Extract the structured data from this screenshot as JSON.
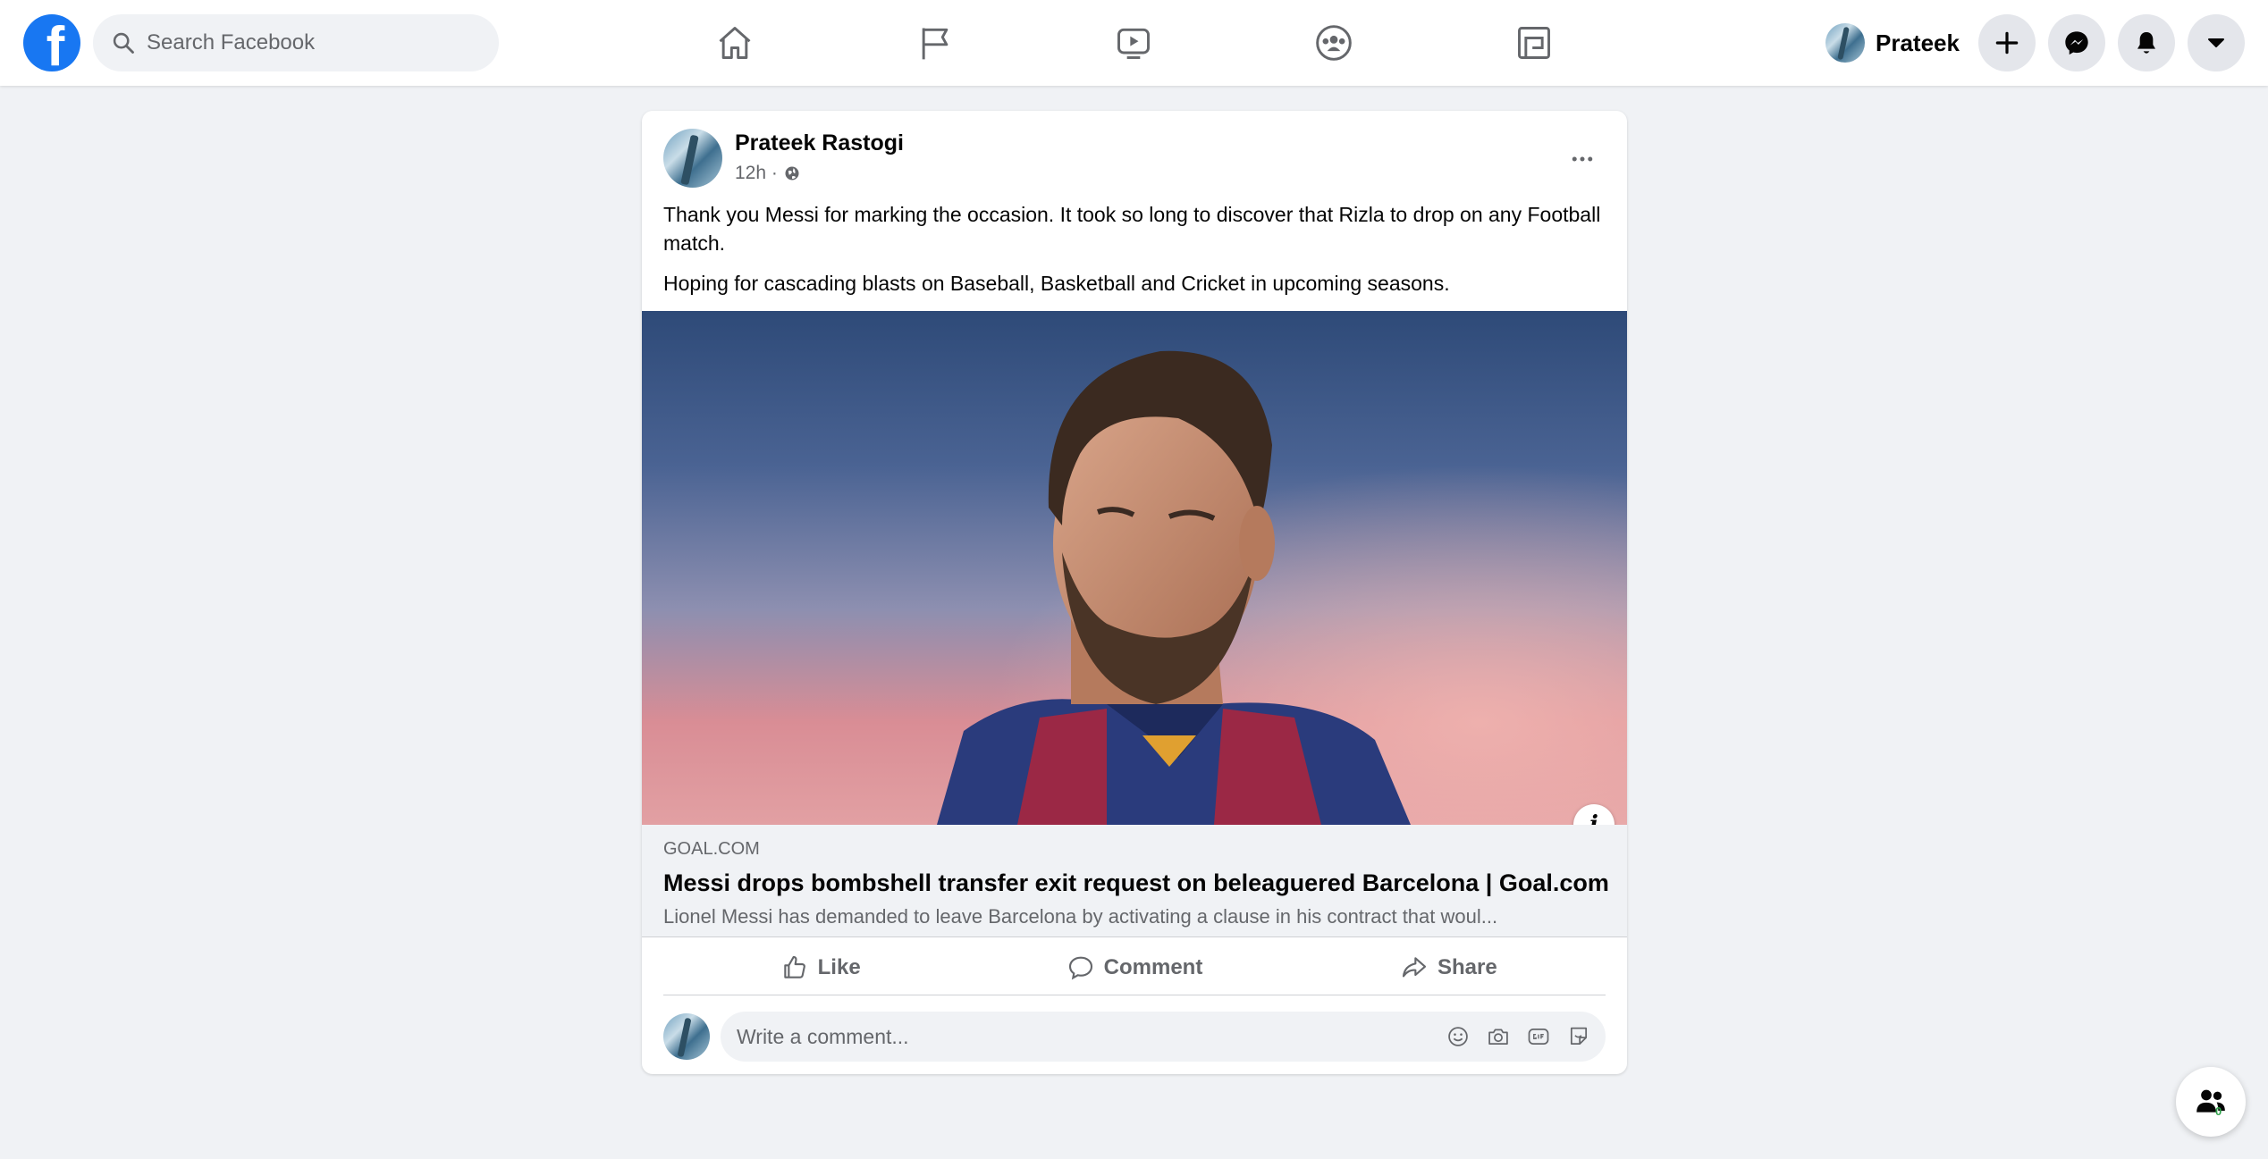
{
  "topbar": {
    "logo": "facebook-logo",
    "search_placeholder": "Search Facebook",
    "nav_icons": [
      "home-icon",
      "pages-flag-icon",
      "watch-video-icon",
      "groups-icon",
      "gaming-icon"
    ],
    "profile_name": "Prateek",
    "action_icons": [
      "create-plus-icon",
      "messenger-icon",
      "notifications-bell-icon",
      "account-caret-icon"
    ]
  },
  "post": {
    "author": "Prateek Rastogi",
    "time": "12h ·",
    "privacy_icon": "globe-icon",
    "paragraphs": [
      "Thank you Messi for marking the occasion. It took so long to discover that Rizla to drop on any Football match.",
      "Hoping for cascading blasts on Baseball, Basketball and Cricket in upcoming seasons."
    ],
    "info_label": "i",
    "link": {
      "domain": "GOAL.COM",
      "title": "Messi drops bombshell transfer exit request on beleaguered Barcelona | Goal.com",
      "description": "Lionel Messi has demanded to leave Barcelona by activating a clause in his contract that woul..."
    },
    "actions": {
      "like": "Like",
      "comment": "Comment",
      "share": "Share"
    },
    "comment_placeholder": "Write a comment...",
    "comment_tools": [
      "emoji-icon",
      "camera-icon",
      "gif-icon",
      "sticker-icon"
    ]
  },
  "contacts": {
    "count": "0"
  },
  "colors": {
    "brand": "#1877f2",
    "background": "#f0f2f5",
    "secondary_text": "#65676b",
    "online": "#31a24c"
  }
}
